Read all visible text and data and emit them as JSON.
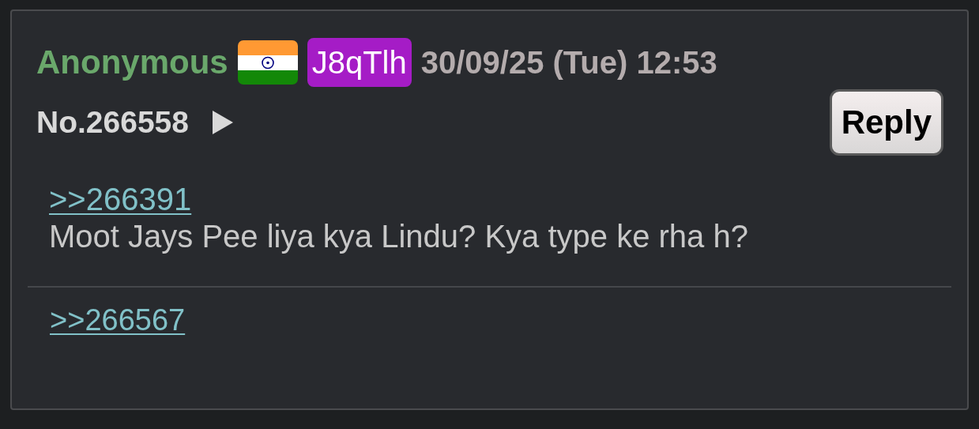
{
  "post": {
    "name": "Anonymous",
    "poster_id": "J8qTlh",
    "datetime": "30/09/25 (Tue) 12:53",
    "number": "No.266558",
    "reply_button": "Reply",
    "quote_link": ">>266391",
    "comment": "Moot Jays Pee liya kya Lindu? Kya type ke rha h?",
    "backlinks": [
      ">>266567"
    ]
  }
}
